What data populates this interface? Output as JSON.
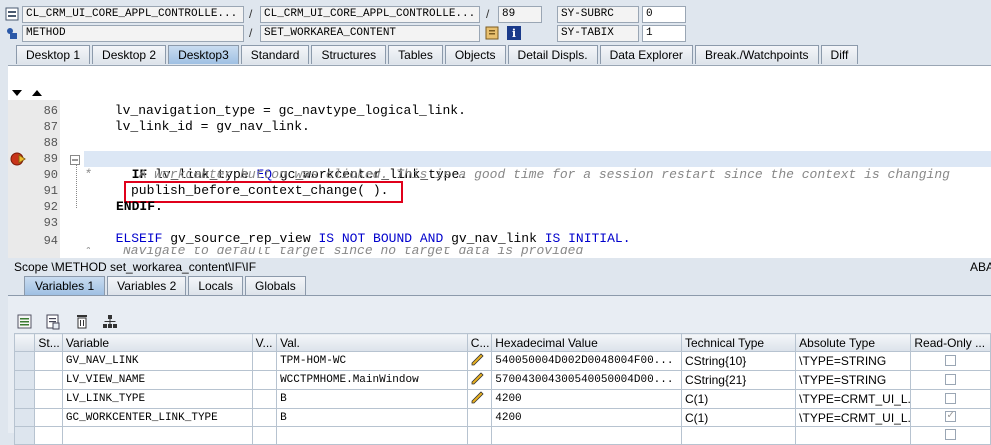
{
  "header": {
    "program": "CL_CRM_UI_CORE_APPL_CONTROLLE...",
    "include": "CL_CRM_UI_CORE_APPL_CONTROLLE...",
    "line": "89",
    "event_type": "METHOD",
    "event": "SET_WORKAREA_CONTENT",
    "sy_subrc_label": "SY-SUBRC",
    "sy_subrc_value": "0",
    "sy_tabix_label": "SY-TABIX",
    "sy_tabix_value": "1"
  },
  "tabs": [
    {
      "label": "Desktop 1"
    },
    {
      "label": "Desktop 2"
    },
    {
      "label": "Desktop3"
    },
    {
      "label": "Standard"
    },
    {
      "label": "Structures"
    },
    {
      "label": "Tables"
    },
    {
      "label": "Objects"
    },
    {
      "label": "Detail Displs."
    },
    {
      "label": "Data Explorer"
    },
    {
      "label": "Break./Watchpoints"
    },
    {
      "label": "Diff"
    }
  ],
  "code": {
    "line_86_no": "86",
    "line_86": "      lv_navigation_type = gc_navtype_logical_link.",
    "line_87_no": "87",
    "line_87": "      lv_link_id = gv_nav_link.",
    "line_88_no": "88",
    "line_89_no": "89",
    "line_89_kw1": "IF",
    "line_89_a": " lv_link_type ",
    "line_89_kw2": "EQ",
    "line_89_b": " gc_workcenter_link_type.",
    "line_90_no": "90",
    "line_90": "*      A workcenter button was clicked. This is a good time for a session restart since the context is changing",
    "line_91_no": "91",
    "line_91": "publish_before_context_change( ).",
    "line_92_no": "92",
    "line_92": "ENDIF.",
    "line_93_no": "93",
    "line_93_kw1": "ELSEIF",
    "line_93_a": " gv_source_rep_view ",
    "line_93_kw2": "IS NOT BOUND AND",
    "line_93_b": " gv_nav_link ",
    "line_93_kw3": "IS INITIAL.",
    "line_94_no": "94",
    "line_95": "*    Navigate to default target since no target data is provided"
  },
  "scope": {
    "text": "Scope \\METHOD set_workarea_content\\IF\\IF",
    "right": "ABA"
  },
  "var_tabs": [
    {
      "label": "Variables 1"
    },
    {
      "label": "Variables 2"
    },
    {
      "label": "Locals"
    },
    {
      "label": "Globals"
    }
  ],
  "columns": {
    "st": "St...",
    "variable": "Variable",
    "v": "V...",
    "val": "Val.",
    "c": "C...",
    "hex": "Hexadecimal Value",
    "tech": "Technical Type",
    "abs": "Absolute Type",
    "ro": "Read-Only ..."
  },
  "rows": [
    {
      "variable": "GV_NAV_LINK",
      "val": "TPM-HOM-WC",
      "hex": "540050004D002D0048004F00...",
      "tech": "CString{10}",
      "abs": "\\TYPE=STRING",
      "editable": true,
      "readonly": false
    },
    {
      "variable": "LV_VIEW_NAME",
      "val": "WCCTPMHOME.MainWindow",
      "hex": "570043004300540050004D00...",
      "tech": "CString{21}",
      "abs": "\\TYPE=STRING",
      "editable": true,
      "readonly": false
    },
    {
      "variable": "LV_LINK_TYPE",
      "val": "B",
      "hex": "4200",
      "tech": "C(1)",
      "abs": "\\TYPE=CRMT_UI_L...",
      "editable": true,
      "readonly": false
    },
    {
      "variable": "GC_WORKCENTER_LINK_TYPE",
      "val": "B",
      "hex": "4200",
      "tech": "C(1)",
      "abs": "\\TYPE=CRMT_UI_L...",
      "editable": false,
      "readonly": true
    }
  ],
  "colors": {
    "highlight_box": "#e0001b",
    "keyword": "#0000cc",
    "active_tab": "#9fc0e3"
  }
}
